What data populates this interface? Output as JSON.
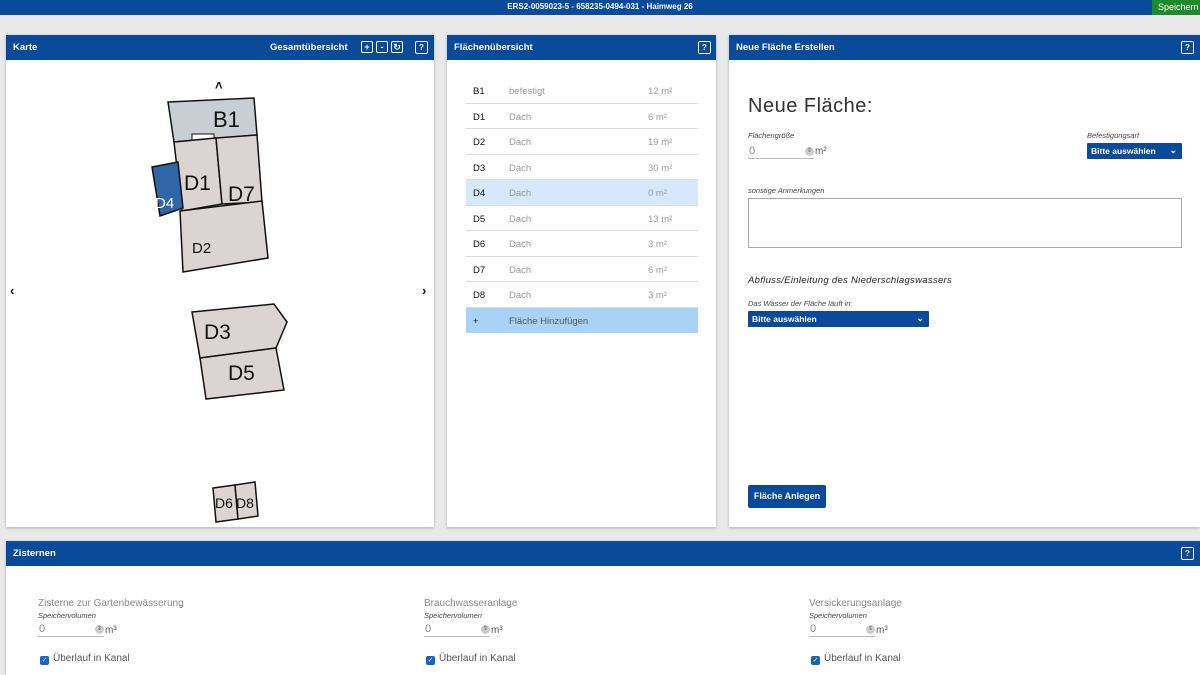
{
  "topbar": {
    "title": "ERS2-0059023-5 - 658235-0494-031 - Haimweg 26",
    "save_label": "Speichern"
  },
  "karte": {
    "title": "Karte",
    "overview_label": "Gesamtübersicht",
    "zoom_in": "+",
    "zoom_out": "-",
    "reset": "↻",
    "help": "?",
    "labels": {
      "B1": "B1",
      "D1": "D1",
      "D2": "D2",
      "D3": "D3",
      "D4": "D4",
      "D5": "D5",
      "D6": "D6",
      "D7": "D7",
      "D8": "D8"
    }
  },
  "flaechen": {
    "title": "Flächenübersicht",
    "help": "?",
    "rows": [
      {
        "id": "B1",
        "type": "befestigt",
        "size": "12 m²"
      },
      {
        "id": "D1",
        "type": "Dach",
        "size": "6 m²"
      },
      {
        "id": "D2",
        "type": "Dach",
        "size": "19 m²"
      },
      {
        "id": "D3",
        "type": "Dach",
        "size": "30 m²"
      },
      {
        "id": "D4",
        "type": "Dach",
        "size": "0 m²"
      },
      {
        "id": "D5",
        "type": "Dach",
        "size": "13 m²"
      },
      {
        "id": "D6",
        "type": "Dach",
        "size": "3 m²"
      },
      {
        "id": "D7",
        "type": "Dach",
        "size": "6 m²"
      },
      {
        "id": "D8",
        "type": "Dach",
        "size": "3 m²"
      }
    ],
    "add_symbol": "+",
    "add_label": "Fläche Hinzufügen"
  },
  "neue": {
    "title": "Neue Fläche Erstellen",
    "help": "?",
    "heading": "Neue Fläche:",
    "size_label": "Flächengröße",
    "size_value": "0",
    "size_unit": "m²",
    "befestigung_label": "Befestigungsart",
    "befestigung_value": "Bitte auswählen",
    "notes_label": "sonstige Anmerkungen",
    "abfluss_heading": "Abfluss/Einleitung des Niederschlagswassers",
    "wasser_label": "Das Wasser der Fläche läuft in:",
    "wasser_value": "Bitte auswählen",
    "submit": "Fläche Anlegen"
  },
  "zisternen": {
    "title": "Zisternen",
    "help": "?",
    "items": [
      {
        "title": "Zisterne zur Gartenbewässerung",
        "vol_label": "Speichervolumen",
        "value": "0",
        "unit": "m³",
        "checkbox": "Überlauf in Kanal"
      },
      {
        "title": "Brauchwasseranlage",
        "vol_label": "Speichervolumen",
        "value": "0",
        "unit": "m³",
        "checkbox": "Überlauf in Kanal"
      },
      {
        "title": "Versickerungsanlage",
        "vol_label": "Speichervolumen",
        "value": "0",
        "unit": "m³",
        "checkbox": "Überlauf in Kanal"
      }
    ]
  },
  "colors": {
    "header": "#0a4a9a",
    "save": "#1f8a2a",
    "selected_row": "#d6e8fb",
    "add_row": "#a9d3f6",
    "roof": "#dcd4d2",
    "paved": "#c9ced4",
    "selected_area": "#2f66a8"
  }
}
